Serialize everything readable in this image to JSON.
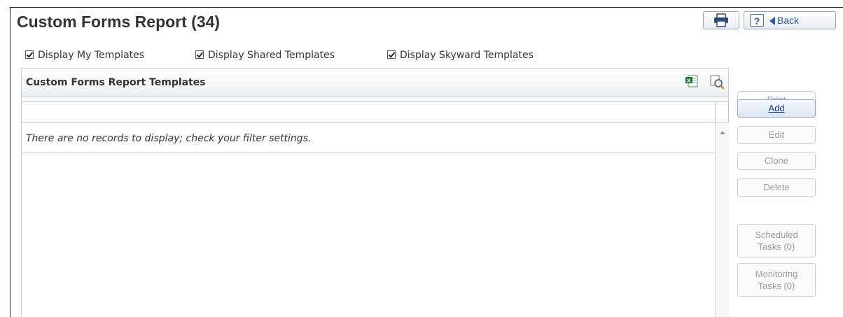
{
  "header": {
    "title": "Custom Forms Report (34)",
    "help_label": "?",
    "back_label": "Back"
  },
  "filters": [
    {
      "label": "Display My Templates",
      "checked": true
    },
    {
      "label": "Display Shared Templates",
      "checked": true
    },
    {
      "label": "Display Skyward Templates",
      "checked": true
    }
  ],
  "panel": {
    "title": "Custom Forms Report Templates",
    "empty_message": "There are no records to display; check your filter settings."
  },
  "actions": {
    "print": "Print",
    "add": "Add",
    "edit": "Edit",
    "clone": "Clone",
    "delete": "Delete",
    "scheduled_line1": "Scheduled",
    "scheduled_line2": "Tasks (0)",
    "monitoring_line1": "Monitoring",
    "monitoring_line2": "Tasks (0)"
  },
  "icons": {
    "printer": "printer-icon",
    "excel": "excel-export-icon",
    "preview": "print-preview-icon"
  },
  "colors": {
    "accent": "#2a5aa8",
    "disabled_text": "#999999",
    "title_text": "#333333"
  }
}
